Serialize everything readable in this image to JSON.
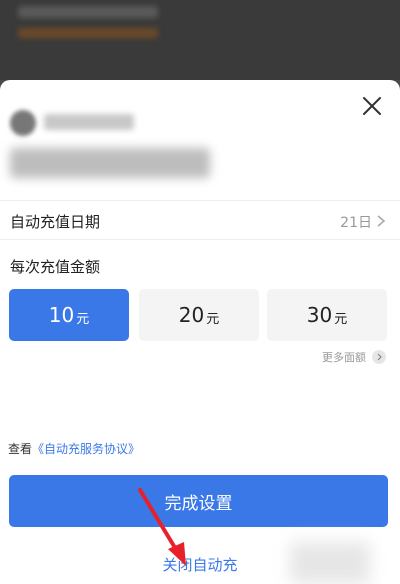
{
  "sheet": {
    "date_row": {
      "label": "自动充值日期",
      "value": "21日"
    },
    "amount_title": "每次充值金额",
    "amounts": [
      {
        "value": "10",
        "unit": "元",
        "selected": true
      },
      {
        "value": "20",
        "unit": "元",
        "selected": false
      },
      {
        "value": "30",
        "unit": "元",
        "selected": false
      }
    ],
    "more_label": "更多面额",
    "agreement": {
      "prefix": "查看",
      "link": "《自动充服务协议》"
    },
    "done_button": "完成设置",
    "close_auto_link": "关闭自动充"
  },
  "icons": {
    "close": "close-icon",
    "chevron": "chevron-right-icon",
    "annotation": "red-arrow-annotation"
  },
  "colors": {
    "accent": "#3b78e7",
    "annotation": "#e8202a"
  }
}
